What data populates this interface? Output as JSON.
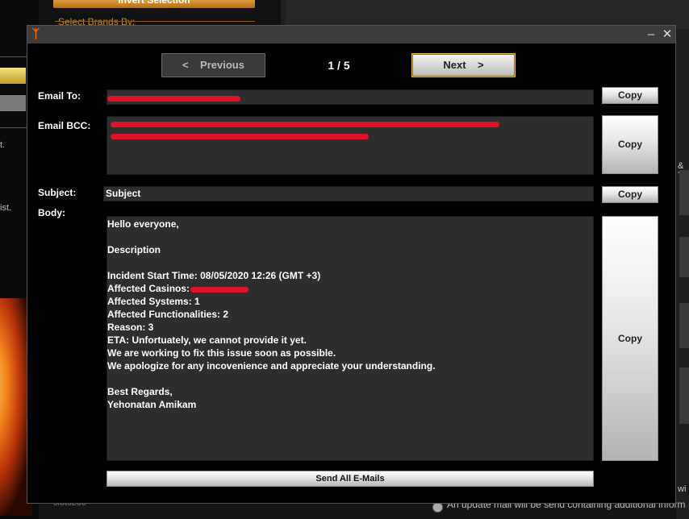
{
  "background": {
    "invert_selection": "Invert Selection",
    "select_brands": "Select Brands By:",
    "left_text_1": "t.",
    "left_text_2": "ist.",
    "right_text_1": "& T",
    "right_text_2": "wi",
    "bottom_status": "An update mail will be send containing additional inform",
    "bottom_slots": "slots200"
  },
  "window": {
    "app_icon": "flame-logo-icon",
    "minimize": "–",
    "close": "✕"
  },
  "nav": {
    "previous": "<    Previous",
    "counter": "1 / 5",
    "next": "Next    >"
  },
  "email_to": {
    "label": "Email To:",
    "copy_label": "Copy"
  },
  "email_bcc": {
    "label": "Email BCC:",
    "copy_label": "Copy"
  },
  "subject": {
    "label": "Subject:",
    "value": "Subject",
    "copy_label": "Copy"
  },
  "body": {
    "label": "Body:",
    "copy_label": "Copy",
    "lines": {
      "greeting": "Hello everyone,",
      "description": "Description",
      "incident_start": "Incident Start Time: 08/05/2020 12:26 (GMT +3)",
      "affected_casinos": "Affected Casinos:",
      "affected_systems": "Affected Systems: 1",
      "affected_functionalities": "Affected Functionalities: 2",
      "reason": "Reason: 3",
      "eta": "ETA: Unfortuately, we cannot provide it yet.",
      "working": "We are working to fix this issue soon as possible.",
      "apology": "We apologize for any incovenience and appreciate your understanding.",
      "regards": "Best Regards,",
      "signature": "Yehonatan Amikam"
    }
  },
  "send_all_label": "Send All E-Mails",
  "colors": {
    "redaction": "#e0122a",
    "next_border": "#e5c04a",
    "field_bg": "#2e2e2e"
  }
}
